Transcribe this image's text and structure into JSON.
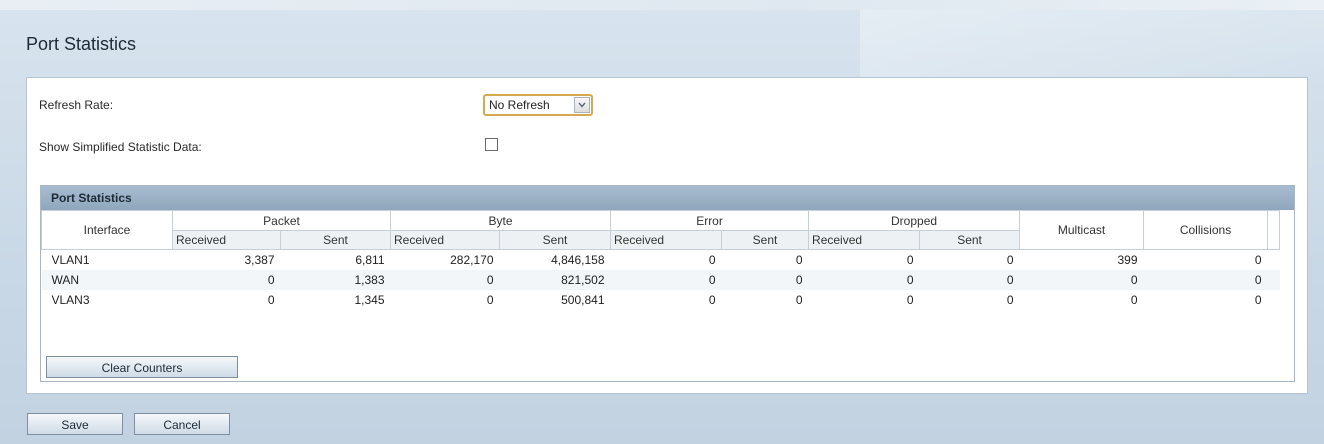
{
  "page": {
    "title": "Port Statistics"
  },
  "settings": {
    "refresh_rate_label": "Refresh Rate:",
    "refresh_rate_value": "No Refresh",
    "simplified_label": "Show Simplified Statistic Data:",
    "simplified_checked": false
  },
  "stats": {
    "section_title": "Port Statistics",
    "headers": {
      "interface": "Interface",
      "packet": "Packet",
      "byte": "Byte",
      "error": "Error",
      "dropped": "Dropped",
      "multicast": "Multicast",
      "collisions": "Collisions",
      "received": "Received",
      "sent": "Sent"
    },
    "rows": [
      {
        "interface": "VLAN1",
        "packet_received": "3,387",
        "packet_sent": "6,811",
        "byte_received": "282,170",
        "byte_sent": "4,846,158",
        "error_received": "0",
        "error_sent": "0",
        "dropped_received": "0",
        "dropped_sent": "0",
        "multicast": "399",
        "collisions": "0"
      },
      {
        "interface": "WAN",
        "packet_received": "0",
        "packet_sent": "1,383",
        "byte_received": "0",
        "byte_sent": "821,502",
        "error_received": "0",
        "error_sent": "0",
        "dropped_received": "0",
        "dropped_sent": "0",
        "multicast": "0",
        "collisions": "0"
      },
      {
        "interface": "VLAN3",
        "packet_received": "0",
        "packet_sent": "1,345",
        "byte_received": "0",
        "byte_sent": "500,841",
        "error_received": "0",
        "error_sent": "0",
        "dropped_received": "0",
        "dropped_sent": "0",
        "multicast": "0",
        "collisions": "0"
      }
    ],
    "clear_button_label": "Clear Counters"
  },
  "footer": {
    "save_label": "Save",
    "cancel_label": "Cancel"
  }
}
